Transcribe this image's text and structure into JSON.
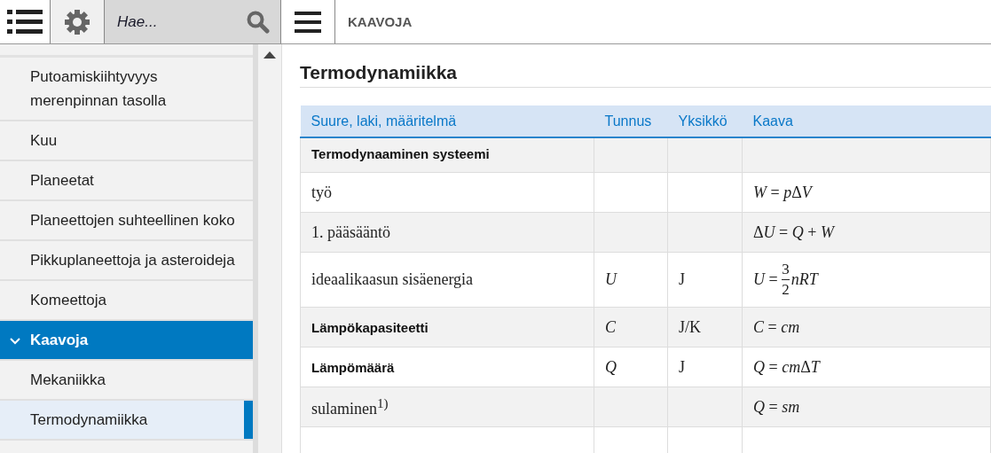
{
  "toolbar": {
    "search": {
      "placeholder": "Hae..."
    },
    "page_title": "KAAVOJA"
  },
  "sidebar": {
    "items": [
      {
        "label": "Putoamiskiihtyvyys merenpinnan tasolla",
        "expanded": false,
        "selected": false
      },
      {
        "label": "Kuu",
        "expanded": false,
        "selected": false
      },
      {
        "label": "Planeetat",
        "expanded": false,
        "selected": false
      },
      {
        "label": "Planeettojen suhteellinen koko",
        "expanded": false,
        "selected": false
      },
      {
        "label": "Pikkuplaneettoja ja asteroideja",
        "expanded": false,
        "selected": false
      },
      {
        "label": "Komeettoja",
        "expanded": false,
        "selected": false
      },
      {
        "label": "Kaavoja",
        "expanded": true,
        "selected": false,
        "children": [
          {
            "label": "Mekaniikka",
            "selected": false
          },
          {
            "label": "Termodynamiikka",
            "selected": true
          }
        ]
      }
    ]
  },
  "content": {
    "heading": "Termodynamiikka",
    "table": {
      "columns": [
        "Suure, laki, määritelmä",
        "Tunnus",
        "Yksikkö",
        "Kaava"
      ],
      "rows": [
        {
          "kind": "heading",
          "cells": [
            "Termodynaaminen systeemi",
            "",
            "",
            ""
          ]
        },
        {
          "kind": "plain",
          "cells": [
            "työ",
            "",
            "",
            [
              {
                "kind": "var",
                "text": "W"
              },
              {
                "kind": "text",
                "text": " = "
              },
              {
                "kind": "var",
                "text": "p"
              },
              {
                "kind": "text",
                "text": "Δ"
              },
              {
                "kind": "var",
                "text": "V"
              }
            ]
          ]
        },
        {
          "kind": "plain",
          "cells": [
            "1. pääsääntö",
            "",
            "",
            [
              {
                "kind": "text",
                "text": "Δ"
              },
              {
                "kind": "var",
                "text": "U"
              },
              {
                "kind": "text",
                "text": " = "
              },
              {
                "kind": "var",
                "text": "Q"
              },
              {
                "kind": "text",
                "text": " + "
              },
              {
                "kind": "var",
                "text": "W"
              }
            ]
          ]
        },
        {
          "kind": "plain",
          "cells": [
            "ideaalikaasun sisäenergia",
            "U",
            "J",
            [
              {
                "kind": "var",
                "text": "U"
              },
              {
                "kind": "text",
                "text": " = "
              },
              {
                "kind": "fraction",
                "num": "3",
                "den": "2"
              },
              {
                "kind": "var",
                "text": "nRT"
              }
            ]
          ]
        },
        {
          "kind": "heading",
          "cells": [
            "Lämpökapasiteetti",
            "C",
            "J/K",
            [
              {
                "kind": "var",
                "text": "C"
              },
              {
                "kind": "text",
                "text": " = "
              },
              {
                "kind": "var",
                "text": "cm"
              }
            ]
          ]
        },
        {
          "kind": "heading",
          "cells": [
            "Lämpömäärä",
            "Q",
            "J",
            [
              {
                "kind": "var",
                "text": "Q"
              },
              {
                "kind": "text",
                "text": " = "
              },
              {
                "kind": "var",
                "text": "cm"
              },
              {
                "kind": "text",
                "text": "Δ"
              },
              {
                "kind": "var",
                "text": "T"
              }
            ]
          ]
        },
        {
          "kind": "plain",
          "cells": [
            "sulaminen$^{1)}$",
            "",
            "",
            [
              {
                "kind": "var",
                "text": "Q"
              },
              {
                "kind": "text",
                "text": " = "
              },
              {
                "kind": "var",
                "text": "sm"
              }
            ]
          ]
        },
        {
          "kind": "plain",
          "cells": [
            "",
            "",
            "",
            ""
          ]
        }
      ]
    }
  }
}
